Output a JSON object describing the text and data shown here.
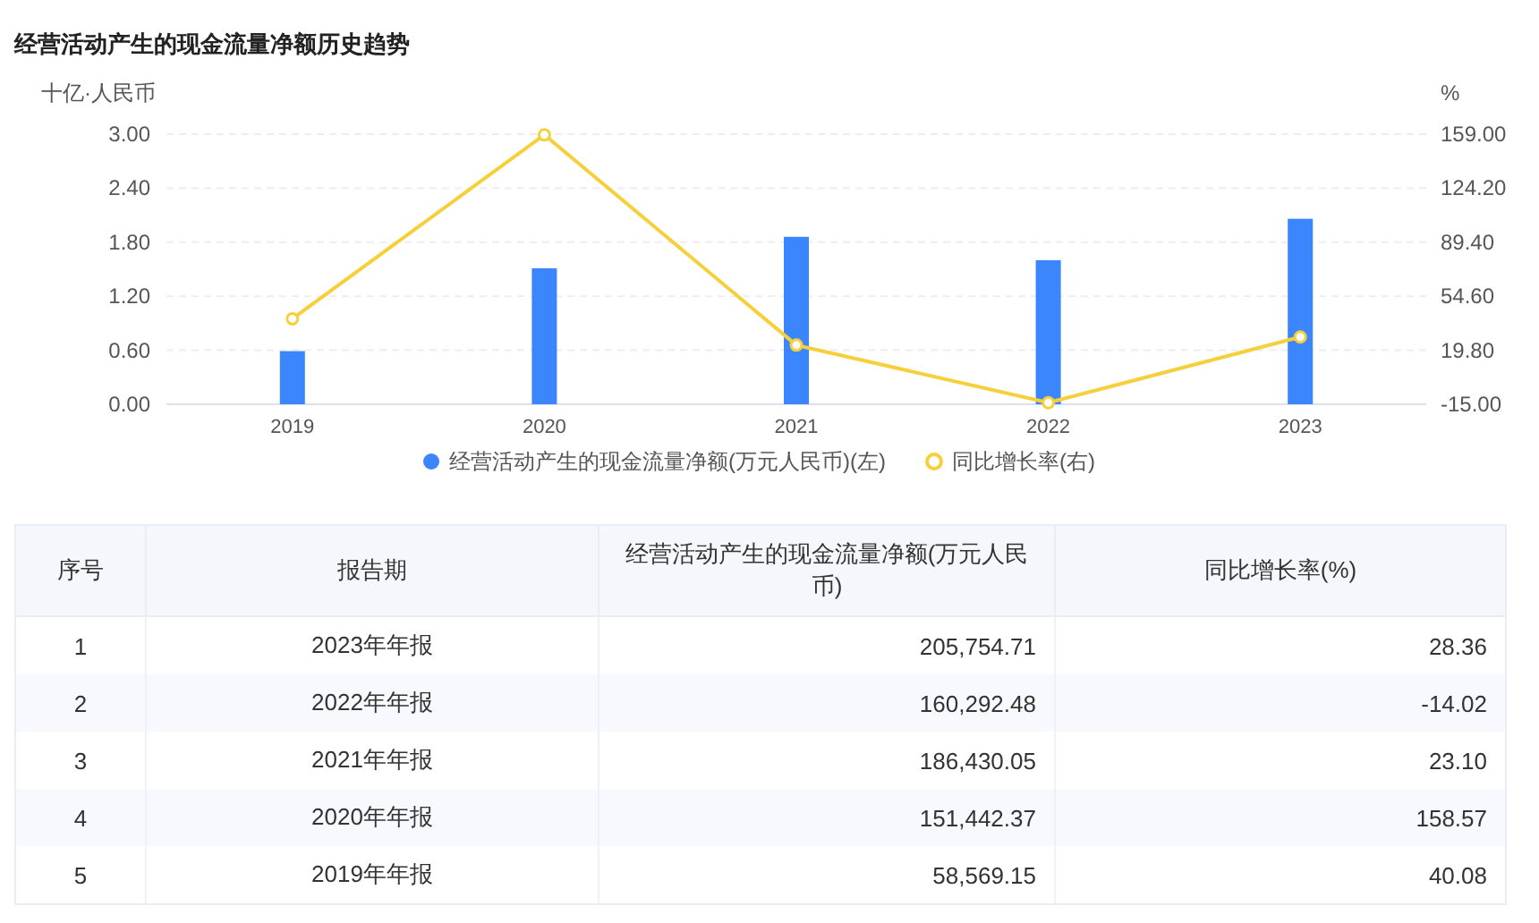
{
  "title": "经营活动产生的现金流量净额历史趋势",
  "chart_data": {
    "type": "bar",
    "ylabel": "十亿·人民币",
    "y2label": "%",
    "categories": [
      "2019",
      "2020",
      "2021",
      "2022",
      "2023"
    ],
    "series": [
      {
        "name": "经营活动产生的现金流量净额(万元人民币)(左)",
        "axis": "y",
        "color": "#3b86fd",
        "values": [
          0.59,
          1.51,
          1.86,
          1.6,
          2.06
        ]
      },
      {
        "name": "同比增长率(右)",
        "type": "line",
        "marker": "circle",
        "axis": "y2",
        "color": "#f6cf3a",
        "values": [
          40.08,
          158.57,
          23.1,
          -14.02,
          28.36
        ]
      }
    ],
    "grid": true,
    "legend": "bottom",
    "ylim": [
      0,
      3
    ],
    "yticks": [
      {
        "value": 0,
        "label": "0.00"
      },
      {
        "value": 0.6,
        "label": "0.60"
      },
      {
        "value": 1.2,
        "label": "1.20"
      },
      {
        "value": 1.8,
        "label": "1.80"
      },
      {
        "value": 2.4,
        "label": "2.40"
      },
      {
        "value": 3,
        "label": "3.00"
      }
    ],
    "y2lim": [
      -15,
      159
    ],
    "y2ticks": [
      {
        "value": -15,
        "label": "-15.00"
      },
      {
        "value": 19.8,
        "label": "19.80"
      },
      {
        "value": 54.6,
        "label": "54.60"
      },
      {
        "value": 89.4,
        "label": "89.40"
      },
      {
        "value": 124.2,
        "label": "124.20"
      },
      {
        "value": 159,
        "label": "159.00"
      }
    ]
  },
  "table": {
    "columns": [
      "序号",
      "报告期",
      "经营活动产生的现金流量净额(万元人民币)",
      "同比增长率(%)"
    ],
    "rows": [
      [
        "1",
        "2023年年报",
        "205,754.71",
        "28.36"
      ],
      [
        "2",
        "2022年年报",
        "160,292.48",
        "-14.02"
      ],
      [
        "3",
        "2021年年报",
        "186,430.05",
        "23.10"
      ],
      [
        "4",
        "2020年年报",
        "151,442.37",
        "158.57"
      ],
      [
        "5",
        "2019年年报",
        "58,569.15",
        "40.08"
      ]
    ]
  }
}
